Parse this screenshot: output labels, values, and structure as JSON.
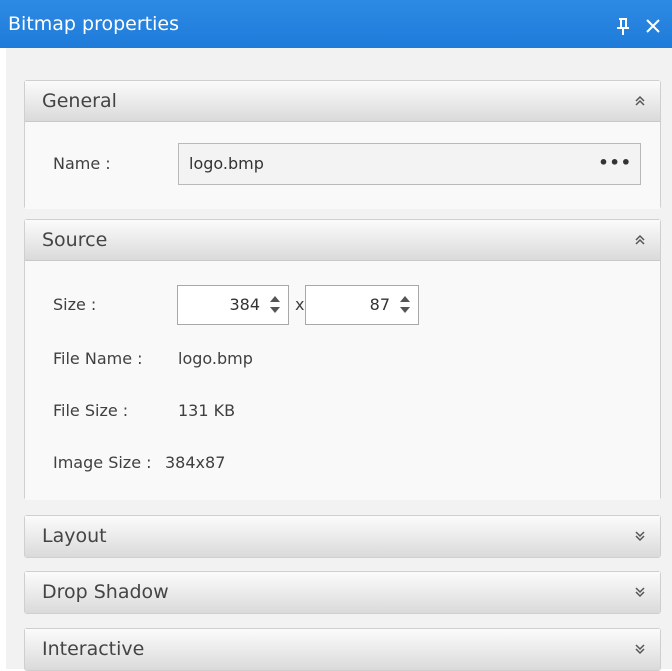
{
  "window": {
    "title": "Bitmap properties",
    "pin_icon": "pin-icon",
    "close_icon": "close-icon",
    "pin_glyph": "q",
    "close_glyph": "✕"
  },
  "sections": {
    "general": {
      "title": "General",
      "state": "expanded",
      "name_label": "Name :",
      "name_value": "logo.bmp",
      "browse_label": "•••"
    },
    "source": {
      "title": "Source",
      "state": "expanded",
      "size_label": "Size :",
      "width_value": "384",
      "separator": "x",
      "height_value": "87",
      "file_name_label": "File Name :",
      "file_name_value": "logo.bmp",
      "file_size_label": "File Size :",
      "file_size_value": "131 KB",
      "image_size_label": "Image Size :",
      "image_size_value": "384x87"
    },
    "layout": {
      "title": "Layout",
      "state": "collapsed"
    },
    "drop_shadow": {
      "title": "Drop Shadow",
      "state": "collapsed"
    },
    "interactive": {
      "title": "Interactive",
      "state": "collapsed"
    }
  },
  "glyphs": {
    "collapse": "˄",
    "expand": "˅"
  },
  "colors": {
    "titlebar": "#2d8ae4",
    "panel_bg": "#f2f2f2",
    "section_border": "#cfcfcf"
  }
}
